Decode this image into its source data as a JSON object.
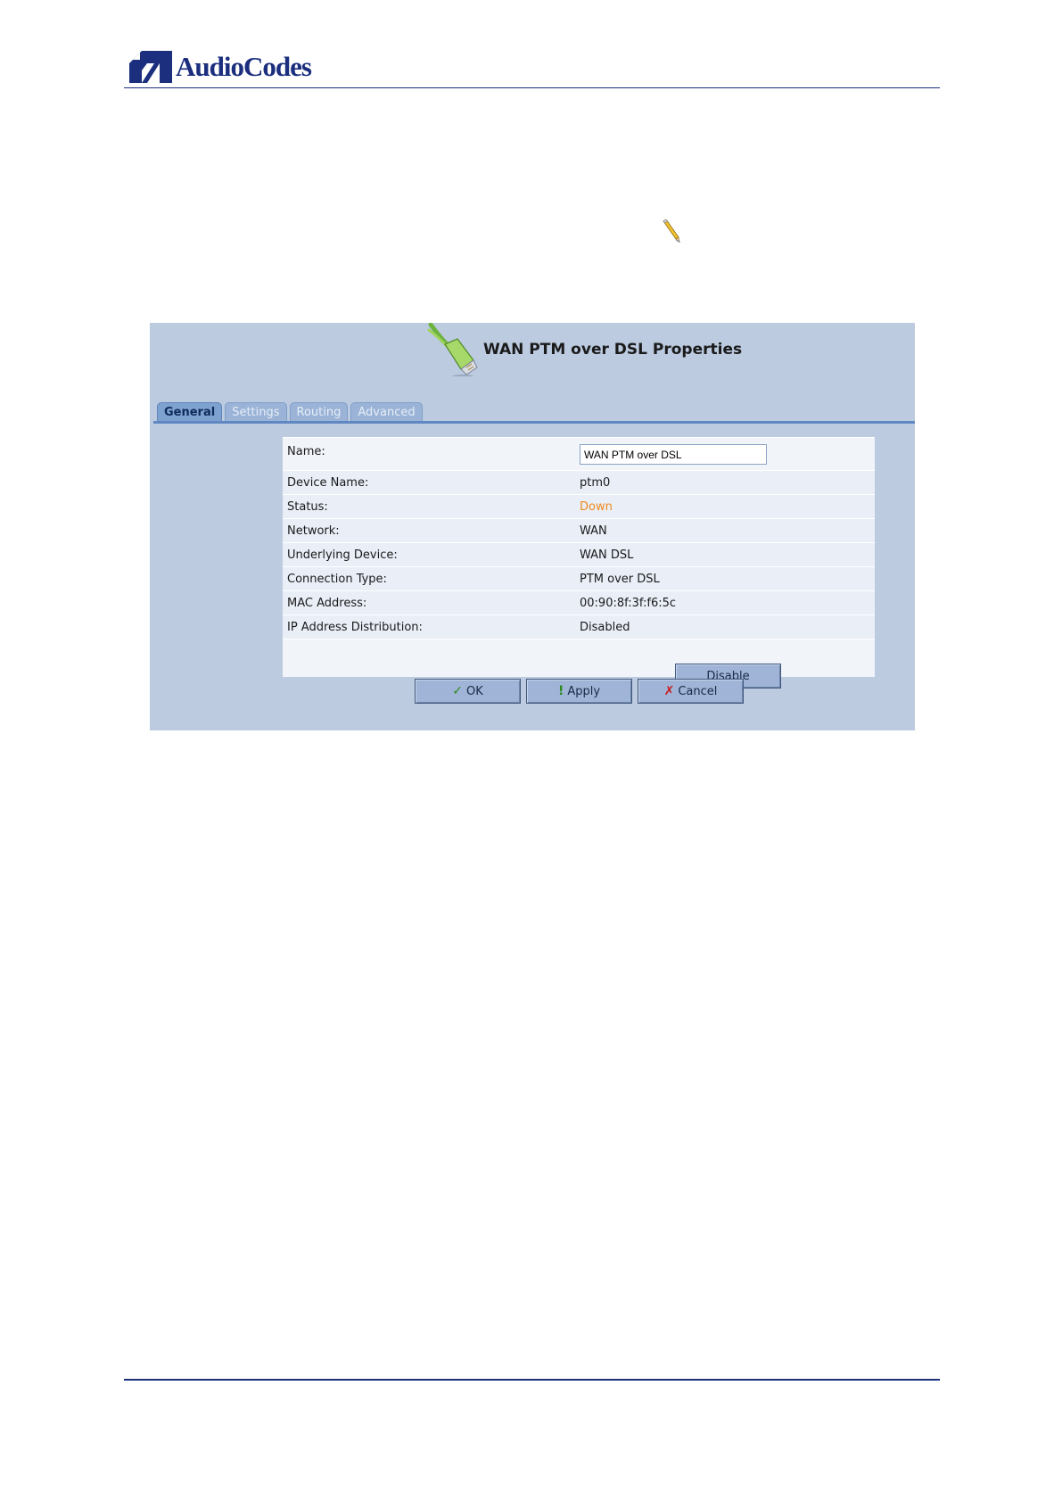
{
  "brand": {
    "logo_text": "AudioCodes",
    "color": "#1b2f7e"
  },
  "dialog": {
    "title": "WAN PTM over DSL Properties",
    "tabs": [
      {
        "label": "General",
        "active": true
      },
      {
        "label": "Settings",
        "active": false
      },
      {
        "label": "Routing",
        "active": false
      },
      {
        "label": "Advanced",
        "active": false
      }
    ],
    "name": {
      "label": "Name:",
      "value": "WAN PTM over DSL"
    },
    "rows": [
      {
        "label": "Device Name:",
        "value": "ptm0"
      },
      {
        "label": "Status:",
        "value": "Down",
        "color": "#f08a1c"
      },
      {
        "label": "Network:",
        "value": "WAN"
      },
      {
        "label": "Underlying Device:",
        "value": "WAN DSL"
      },
      {
        "label": "Connection Type:",
        "value": "PTM over DSL"
      },
      {
        "label": "MAC Address:",
        "value": "00:90:8f:3f:f6:5c"
      },
      {
        "label": "IP Address Distribution:",
        "value": "Disabled"
      }
    ],
    "disable_label": "Disable",
    "buttons": {
      "ok": "OK",
      "apply": "Apply",
      "cancel": "Cancel"
    }
  },
  "icons": {
    "edit": "pencil-icon",
    "dialog": "network-cable-icon",
    "ok": "checkmark-icon",
    "apply": "exclamation-icon",
    "cancel": "x-mark-icon"
  }
}
